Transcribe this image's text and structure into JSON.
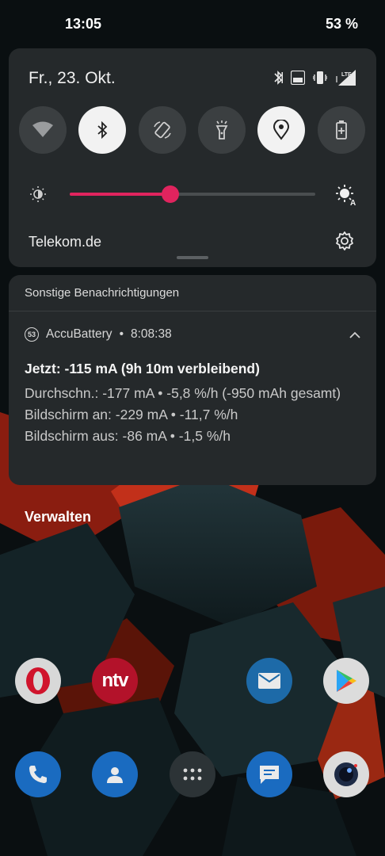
{
  "status_bar": {
    "time": "13:05",
    "battery": "53 %"
  },
  "quick_settings": {
    "date": "Fr., 23. Okt.",
    "carrier": "Telekom.de",
    "status_icons": [
      "bluetooth-icon",
      "volte-icon",
      "vibrate-icon",
      "lte-signal-icon"
    ],
    "lte_label": "LTE",
    "volte_label": "VoLTE",
    "tiles": [
      {
        "name": "wifi",
        "icon": "wifi-icon",
        "active": false
      },
      {
        "name": "bluetooth",
        "icon": "bluetooth-icon",
        "active": true
      },
      {
        "name": "auto-rotate",
        "icon": "rotate-icon",
        "active": false
      },
      {
        "name": "flashlight",
        "icon": "flashlight-icon",
        "active": false
      },
      {
        "name": "location",
        "icon": "location-icon",
        "active": true
      },
      {
        "name": "battery-saver",
        "icon": "battery-saver-icon",
        "active": false
      }
    ],
    "brightness_fraction": 0.41,
    "accent_color": "#e0245e"
  },
  "notification": {
    "section_title": "Sonstige Benachrichtigungen",
    "app_badge": "53",
    "app_name": "AccuBattery",
    "time": "8:08:38",
    "title": "Jetzt: -115 mA (9h 10m verbleibend)",
    "lines": [
      "Durchschn.: -177 mA • -5,8 %/h (-950 mAh gesamt)",
      "Bildschirm an: -229 mA • -11,7 %/h",
      "Bildschirm aus: -86 mA • -1,5 %/h"
    ]
  },
  "manage_label": "Verwalten",
  "home_apps": [
    {
      "name": "opera",
      "icon": "opera-icon"
    },
    {
      "name": "ntv",
      "label": "ntv",
      "icon": "ntv-icon"
    },
    {
      "name": "email",
      "icon": "mail-icon"
    },
    {
      "name": "play-store",
      "icon": "play-store-icon"
    },
    {
      "name": "phone",
      "icon": "phone-icon"
    },
    {
      "name": "contacts",
      "icon": "contacts-icon"
    },
    {
      "name": "app-drawer",
      "icon": "app-drawer-icon"
    },
    {
      "name": "messages",
      "icon": "messages-icon"
    },
    {
      "name": "camera",
      "icon": "camera-icon"
    }
  ]
}
